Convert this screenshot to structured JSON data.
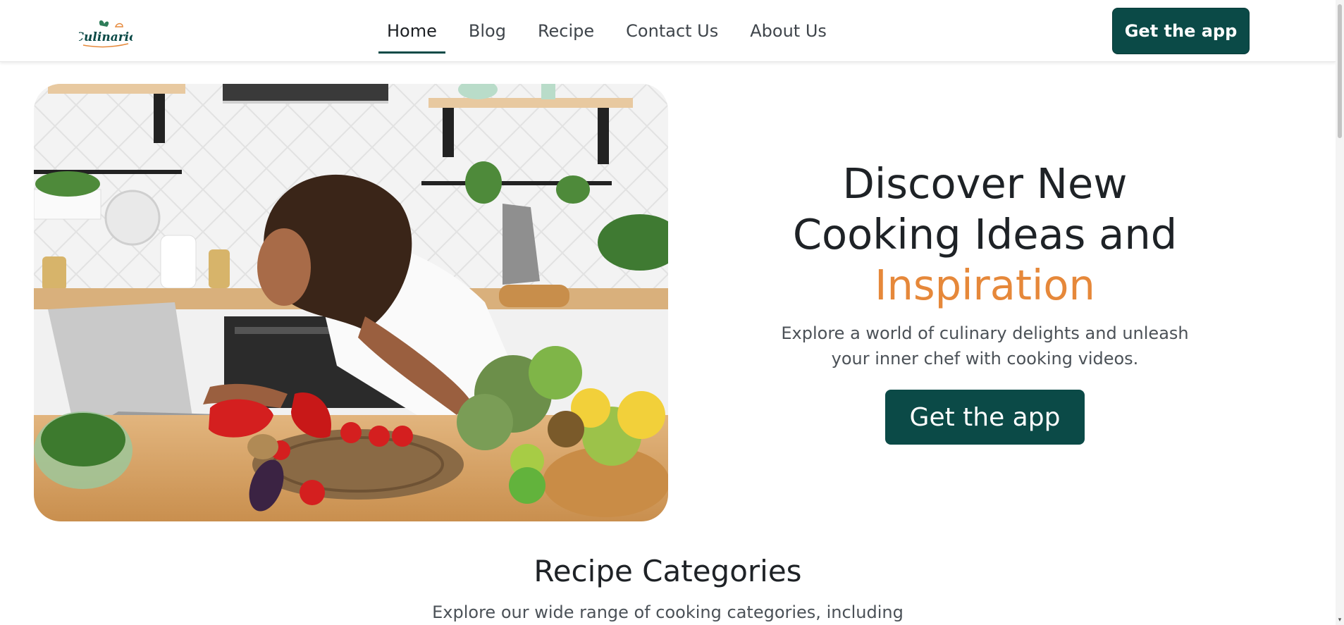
{
  "brand": {
    "logo_text": "Culinario",
    "primary_color": "#0b4a47",
    "accent_color": "#e6883a"
  },
  "nav": {
    "items": [
      {
        "label": "Home",
        "active": true
      },
      {
        "label": "Blog",
        "active": false
      },
      {
        "label": "Recipe",
        "active": false
      },
      {
        "label": "Contact Us",
        "active": false
      },
      {
        "label": "About Us",
        "active": false
      }
    ],
    "cta_label": "Get the app"
  },
  "hero": {
    "title_line1": "Discover New",
    "title_line2": "Cooking Ideas and",
    "title_accent": "Inspiration",
    "subtitle": "Explore a world of culinary delights and unleash your inner chef with cooking videos.",
    "cta_label": "Get the app",
    "image": "kitchen-woman-laptop-vegetables"
  },
  "categories": {
    "title": "Recipe Categories",
    "subtitle": "Explore our wide range of cooking categories, including"
  }
}
